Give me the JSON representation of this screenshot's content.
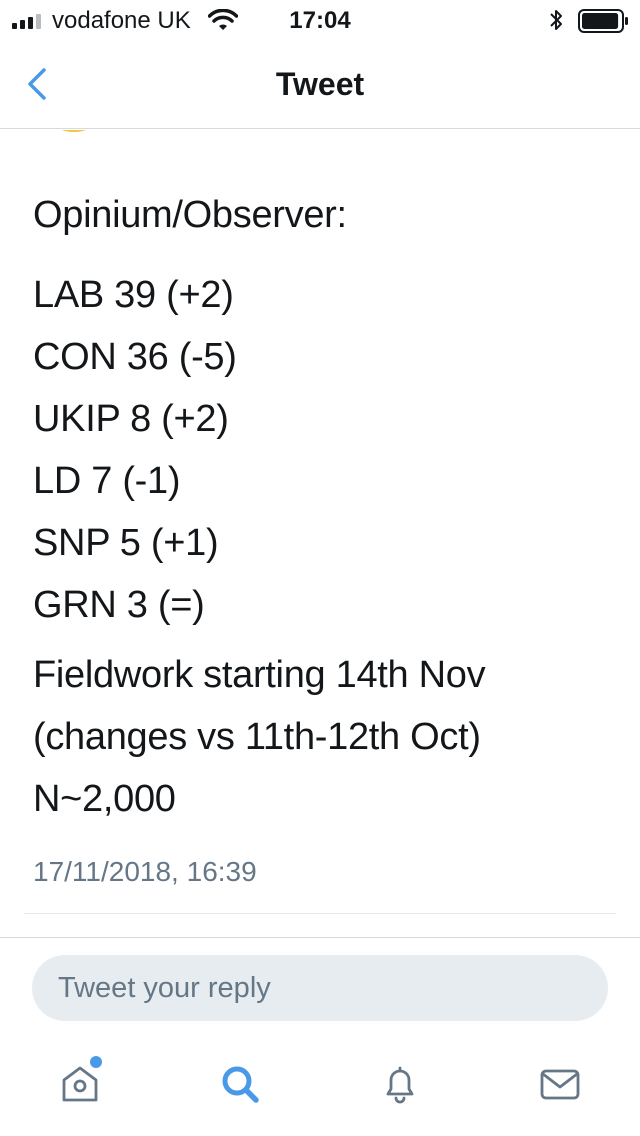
{
  "status_bar": {
    "carrier": "vodafone UK",
    "time": "17:04",
    "signal_bars": 3,
    "battery_level": 0.95
  },
  "nav": {
    "title": "Tweet",
    "back_icon": "chevron-left-icon",
    "accent_color": "#4a99e9"
  },
  "tweet": {
    "heading": "Opinium/Observer:",
    "poll_lines": [
      "LAB 39 (+2)",
      "CON 36 (-5)",
      "UKIP 8 (+2)",
      "LD 7 (-1)",
      "SNP 5 (+1)",
      "GRN 3 (=)"
    ],
    "footer_lines": [
      "Fieldwork starting 14th Nov",
      "(changes vs 11th-12th Oct)",
      "N~2,000"
    ],
    "timestamp": "17/11/2018, 16:39"
  },
  "reply": {
    "placeholder": "Tweet your reply"
  },
  "tab_bar": {
    "tabs": [
      {
        "icon": "home-icon",
        "active": false,
        "has_dot": true
      },
      {
        "icon": "search-icon",
        "active": true,
        "has_dot": false
      },
      {
        "icon": "bell-icon",
        "active": false,
        "has_dot": false
      },
      {
        "icon": "mail-icon",
        "active": false,
        "has_dot": false
      }
    ]
  },
  "colors": {
    "accent": "#4a99e9",
    "text": "#14171a",
    "muted": "#657786",
    "reply_bg": "#e6ecf0"
  }
}
